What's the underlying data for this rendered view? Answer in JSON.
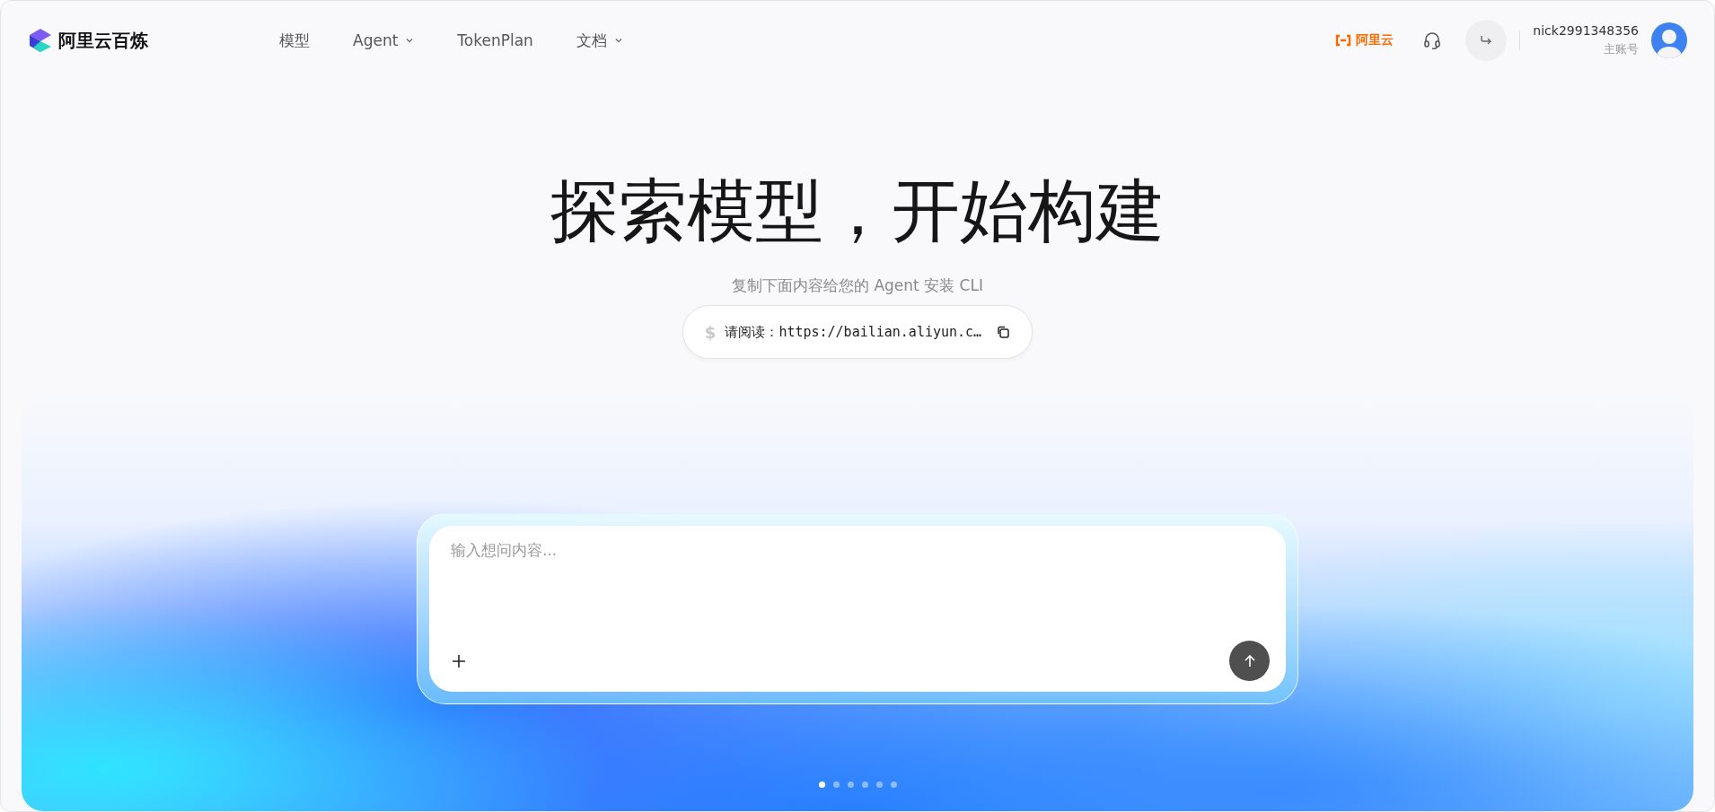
{
  "header": {
    "brand": "阿里云百炼",
    "nav": [
      {
        "label": "模型",
        "has_dropdown": false
      },
      {
        "label": "Agent",
        "has_dropdown": true
      },
      {
        "label": "TokenPlan",
        "has_dropdown": false
      },
      {
        "label": "文档",
        "has_dropdown": true
      }
    ],
    "cloud_link": "阿里云",
    "user": {
      "name": "nick2991348356",
      "role": "主账号"
    }
  },
  "hero": {
    "title": "探索模型，开始构建",
    "subtitle": "复制下面内容给您的 Agent 安装 CLI",
    "command": {
      "prompt": "$",
      "text": "请阅读：https://bailian.aliyun.c…"
    }
  },
  "chat": {
    "placeholder": "输入想问内容..."
  },
  "carousel_dots": [
    {
      "selected": true
    },
    {
      "selected": false
    },
    {
      "selected": false
    },
    {
      "selected": false
    },
    {
      "selected": false
    },
    {
      "selected": false
    }
  ]
}
